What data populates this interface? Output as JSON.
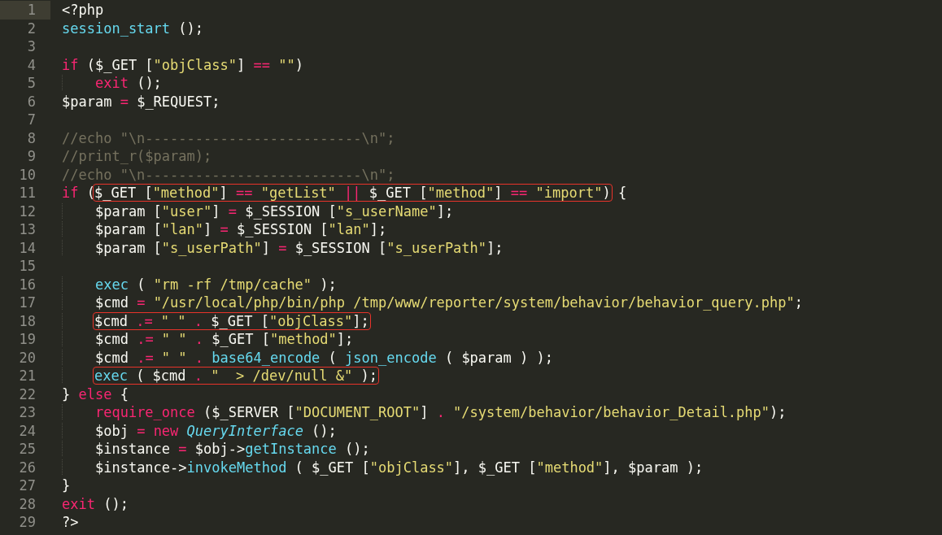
{
  "editor": {
    "lines": [
      {
        "number": "1",
        "selected": true,
        "tokens": [
          {
            "kind": "plain",
            "text": "<?php"
          }
        ]
      },
      {
        "number": "2",
        "selected": false,
        "tokens": [
          {
            "kind": "function",
            "text": "session_start"
          },
          {
            "kind": "plain",
            "text": " ();"
          }
        ]
      },
      {
        "number": "3",
        "selected": false
      },
      {
        "number": "4",
        "selected": false,
        "tokens": [
          {
            "kind": "keyword",
            "text": "if"
          },
          {
            "kind": "plain",
            "text": " ($_GET ["
          },
          {
            "kind": "string",
            "text": "\"objClass\""
          },
          {
            "kind": "plain",
            "text": "] "
          },
          {
            "kind": "operator",
            "text": "== "
          },
          {
            "kind": "string",
            "text": "\"\""
          },
          {
            "kind": "plain",
            "text": ")"
          }
        ]
      },
      {
        "number": "5",
        "selected": false,
        "tokens": [
          {
            "kind": "keyword",
            "text": "    exit"
          },
          {
            "kind": "plain",
            "text": " ();"
          }
        ]
      },
      {
        "number": "6",
        "selected": false,
        "tokens": [
          {
            "kind": "plain",
            "text": "$param "
          },
          {
            "kind": "operator",
            "text": "="
          },
          {
            "kind": "plain",
            "text": " $_REQUEST;"
          }
        ]
      },
      {
        "number": "7",
        "selected": false
      },
      {
        "number": "8",
        "selected": false,
        "tokens": [
          {
            "kind": "comment",
            "text": "//echo \"\\n--------------------------\\n\";"
          }
        ]
      },
      {
        "number": "9",
        "selected": false,
        "tokens": [
          {
            "kind": "comment",
            "text": "//print_r($param);"
          }
        ]
      },
      {
        "number": "10",
        "selected": false,
        "tokens": [
          {
            "kind": "comment",
            "text": "//echo \"\\n--------------------------\\n\";"
          }
        ]
      },
      {
        "number": "11",
        "selected": false,
        "tokens": [
          {
            "kind": "keyword",
            "text": "if"
          },
          {
            "kind": "plain",
            "text": " ("
          },
          {
            "kind": "highlight",
            "tokens": [
              {
                "kind": "plain",
                "text": "$_GET ["
              },
              {
                "kind": "string",
                "text": "\"method\""
              },
              {
                "kind": "plain",
                "text": "] "
              },
              {
                "kind": "operator",
                "text": "== "
              },
              {
                "kind": "string",
                "text": "\"getList\""
              },
              {
                "kind": "operator",
                "text": " || "
              },
              {
                "kind": "plain",
                "text": "$_GET ["
              },
              {
                "kind": "string",
                "text": "\"method\""
              },
              {
                "kind": "plain",
                "text": "] "
              },
              {
                "kind": "operator",
                "text": "== "
              },
              {
                "kind": "string",
                "text": "\"import\""
              },
              {
                "kind": "plain",
                "text": ")"
              }
            ]
          },
          {
            "kind": "plain",
            "text": " {"
          }
        ]
      },
      {
        "number": "12",
        "selected": false,
        "tokens": [
          {
            "kind": "plain",
            "text": "    $param ["
          },
          {
            "kind": "string",
            "text": "\"user\""
          },
          {
            "kind": "plain",
            "text": "] "
          },
          {
            "kind": "operator",
            "text": "="
          },
          {
            "kind": "plain",
            "text": " $_SESSION ["
          },
          {
            "kind": "string",
            "text": "\"s_userName\""
          },
          {
            "kind": "plain",
            "text": "];"
          }
        ]
      },
      {
        "number": "13",
        "selected": false,
        "tokens": [
          {
            "kind": "plain",
            "text": "    $param ["
          },
          {
            "kind": "string",
            "text": "\"lan\""
          },
          {
            "kind": "plain",
            "text": "] "
          },
          {
            "kind": "operator",
            "text": "="
          },
          {
            "kind": "plain",
            "text": " $_SESSION ["
          },
          {
            "kind": "string",
            "text": "\"lan\""
          },
          {
            "kind": "plain",
            "text": "];"
          }
        ]
      },
      {
        "number": "14",
        "selected": false,
        "tokens": [
          {
            "kind": "plain",
            "text": "    $param ["
          },
          {
            "kind": "string",
            "text": "\"s_userPath\""
          },
          {
            "kind": "plain",
            "text": "] "
          },
          {
            "kind": "operator",
            "text": "="
          },
          {
            "kind": "plain",
            "text": " $_SESSION ["
          },
          {
            "kind": "string",
            "text": "\"s_userPath\""
          },
          {
            "kind": "plain",
            "text": "];"
          }
        ]
      },
      {
        "number": "15",
        "selected": false
      },
      {
        "number": "16",
        "selected": false,
        "tokens": [
          {
            "kind": "function",
            "text": "    exec"
          },
          {
            "kind": "plain",
            "text": " ( "
          },
          {
            "kind": "string",
            "text": "\"rm -rf /tmp/cache\""
          },
          {
            "kind": "plain",
            "text": " );"
          }
        ]
      },
      {
        "number": "17",
        "selected": false,
        "tokens": [
          {
            "kind": "plain",
            "text": "    $cmd "
          },
          {
            "kind": "operator",
            "text": "= "
          },
          {
            "kind": "string",
            "text": "\"/usr/local/php/bin/php /tmp/www/reporter/system/behavior/behavior_query.php\""
          },
          {
            "kind": "plain",
            "text": ";"
          }
        ]
      },
      {
        "number": "18",
        "selected": false,
        "tokens": [
          {
            "kind": "highlight",
            "tokens": [
              {
                "kind": "plain",
                "text": "$cmd "
              },
              {
                "kind": "operator",
                "text": ".= "
              },
              {
                "kind": "string",
                "text": "\" \""
              },
              {
                "kind": "operator",
                "text": " ."
              },
              {
                "kind": "plain",
                "text": " $_GET ["
              },
              {
                "kind": "string",
                "text": "\"objClass\""
              },
              {
                "kind": "plain",
                "text": "];"
              }
            ]
          }
        ]
      },
      {
        "number": "19",
        "selected": false,
        "tokens": [
          {
            "kind": "plain",
            "text": "    $cmd "
          },
          {
            "kind": "operator",
            "text": ".= "
          },
          {
            "kind": "string",
            "text": "\" \""
          },
          {
            "kind": "operator",
            "text": " ."
          },
          {
            "kind": "plain",
            "text": " $_GET ["
          },
          {
            "kind": "string",
            "text": "\"method\""
          },
          {
            "kind": "plain",
            "text": "];"
          }
        ]
      },
      {
        "number": "20",
        "selected": false,
        "tokens": [
          {
            "kind": "plain",
            "text": "    $cmd "
          },
          {
            "kind": "operator",
            "text": ".= "
          },
          {
            "kind": "string",
            "text": "\" \""
          },
          {
            "kind": "operator",
            "text": " . "
          },
          {
            "kind": "function",
            "text": "base64_encode"
          },
          {
            "kind": "plain",
            "text": " ( "
          },
          {
            "kind": "function",
            "text": "json_encode"
          },
          {
            "kind": "plain",
            "text": " ( $param ) );"
          }
        ]
      },
      {
        "number": "21",
        "selected": false,
        "tokens": [
          {
            "kind": "highlight",
            "tokens": [
              {
                "kind": "function",
                "text": "exec"
              },
              {
                "kind": "plain",
                "text": " ( $cmd "
              },
              {
                "kind": "operator",
                "text": ". "
              },
              {
                "kind": "string",
                "text": "\"  > /dev/null &\""
              },
              {
                "kind": "plain",
                "text": " );"
              }
            ]
          }
        ]
      },
      {
        "number": "22",
        "selected": false,
        "tokens": [
          {
            "kind": "plain",
            "text": "} "
          },
          {
            "kind": "keyword",
            "text": "else"
          },
          {
            "kind": "plain",
            "text": " {"
          }
        ]
      },
      {
        "number": "23",
        "selected": false,
        "tokens": [
          {
            "kind": "keyword",
            "text": "    require_once"
          },
          {
            "kind": "plain",
            "text": " ($_SERVER ["
          },
          {
            "kind": "string",
            "text": "\"DOCUMENT_ROOT\""
          },
          {
            "kind": "plain",
            "text": "] "
          },
          {
            "kind": "operator",
            "text": ". "
          },
          {
            "kind": "string",
            "text": "\"/system/behavior/behavior_Detail.php\""
          },
          {
            "kind": "plain",
            "text": ");"
          }
        ]
      },
      {
        "number": "24",
        "selected": false,
        "tokens": [
          {
            "kind": "plain",
            "text": "    $obj "
          },
          {
            "kind": "operator",
            "text": "= "
          },
          {
            "kind": "keyword",
            "text": "new "
          },
          {
            "kind": "class",
            "text": "QueryInterface"
          },
          {
            "kind": "plain",
            "text": " ();"
          }
        ]
      },
      {
        "number": "25",
        "selected": false,
        "tokens": [
          {
            "kind": "plain",
            "text": "    $instance "
          },
          {
            "kind": "operator",
            "text": "="
          },
          {
            "kind": "plain",
            "text": " $obj->"
          },
          {
            "kind": "function",
            "text": "getInstance"
          },
          {
            "kind": "plain",
            "text": " ();"
          }
        ]
      },
      {
        "number": "26",
        "selected": false,
        "tokens": [
          {
            "kind": "plain",
            "text": "    $instance->"
          },
          {
            "kind": "function",
            "text": "invokeMethod"
          },
          {
            "kind": "plain",
            "text": " ( $_GET ["
          },
          {
            "kind": "string",
            "text": "\"objClass\""
          },
          {
            "kind": "plain",
            "text": "], $_GET ["
          },
          {
            "kind": "string",
            "text": "\"method\""
          },
          {
            "kind": "plain",
            "text": "], $param );"
          }
        ]
      },
      {
        "number": "27",
        "selected": false,
        "tokens": [
          {
            "kind": "plain",
            "text": "}"
          }
        ]
      },
      {
        "number": "28",
        "selected": false,
        "tokens": [
          {
            "kind": "keyword",
            "text": "exit"
          },
          {
            "kind": "plain",
            "text": " ();"
          }
        ]
      },
      {
        "number": "29",
        "selected": false,
        "tokens": [
          {
            "kind": "plain",
            "text": "?>"
          }
        ]
      }
    ]
  }
}
